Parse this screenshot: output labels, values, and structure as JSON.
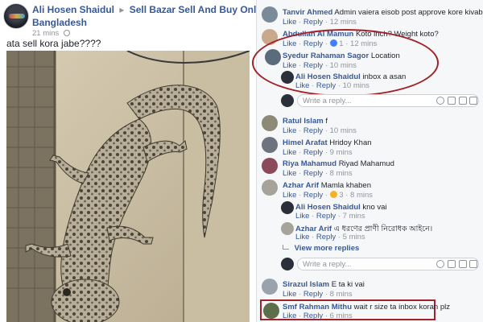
{
  "post": {
    "author": "Ali Hosen Shaidul",
    "arrow": "▸",
    "group": "Sell Bazar Sell And Buy Only",
    "group_line2": "Bangladesh",
    "time": "21 mins",
    "privacy_icon": "globe-icon",
    "text": "ata sell kora jabe????"
  },
  "comments": [
    {
      "name": "Tanvir Ahmed",
      "text": "Admin vaiera eisob post approve kore kivabe",
      "like": "Like",
      "reply": "Reply",
      "time": "12 mins"
    },
    {
      "name": "Abdullah Al Mamun",
      "text": "Koto inch? Weight koto?",
      "like": "Like",
      "reply": "Reply",
      "reactions": "1",
      "time": "12 mins"
    },
    {
      "name": "Syedur Rahaman Sagor",
      "text": "Location",
      "like": "Like",
      "reply": "Reply",
      "time": "10 mins"
    },
    {
      "name": "Ratul Islam",
      "text": "f",
      "like": "Like",
      "reply": "Reply",
      "time": "10 mins"
    },
    {
      "name": "Himel Arafat",
      "text": "Hridoy Khan",
      "like": "Like",
      "reply": "Reply",
      "time": "9 mins"
    },
    {
      "name": "Riya Mahamud",
      "text": "Riyad Mahamud",
      "like": "Like",
      "reply": "Reply",
      "time": "8 mins"
    },
    {
      "name": "Azhar Arif",
      "text": "Mamla khaben",
      "like": "Like",
      "reply": "Reply",
      "reactions": "3",
      "time": "8 mins"
    },
    {
      "name": "Sirazul Islam",
      "text": "E ta ki vai",
      "like": "Like",
      "reply": "Reply",
      "time": "8 mins"
    },
    {
      "name": "Smf Rahman Mithu",
      "text": "wait r size ta inbox koran plz",
      "like": "Like",
      "reply": "Reply",
      "time": "6 mins"
    }
  ],
  "replies": [
    {
      "name": "Ali Hosen Shaidul",
      "text": "inbox a asan",
      "like": "Like",
      "reply": "Reply",
      "time": "10 mins"
    },
    {
      "name": "Ali Hosen Shaidul",
      "text": "kno vai",
      "like": "Like",
      "reply": "Reply",
      "time": "7 mins"
    },
    {
      "name": "Azhar Arif",
      "text": "এ ধরণের প্রাণী নিরোধক আইনে।",
      "like": "Like",
      "reply": "Reply",
      "time": "5 mins"
    }
  ],
  "view_more": "View more replies",
  "write_placeholder": "Write a reply...",
  "icons": {
    "emoji": "emoji-icon",
    "camera": "camera-icon",
    "gif": "gif-icon",
    "sticker": "sticker-icon"
  },
  "colors": {
    "link": "#365899",
    "highlight": "#a3222a",
    "background": "#f6f7f9"
  }
}
